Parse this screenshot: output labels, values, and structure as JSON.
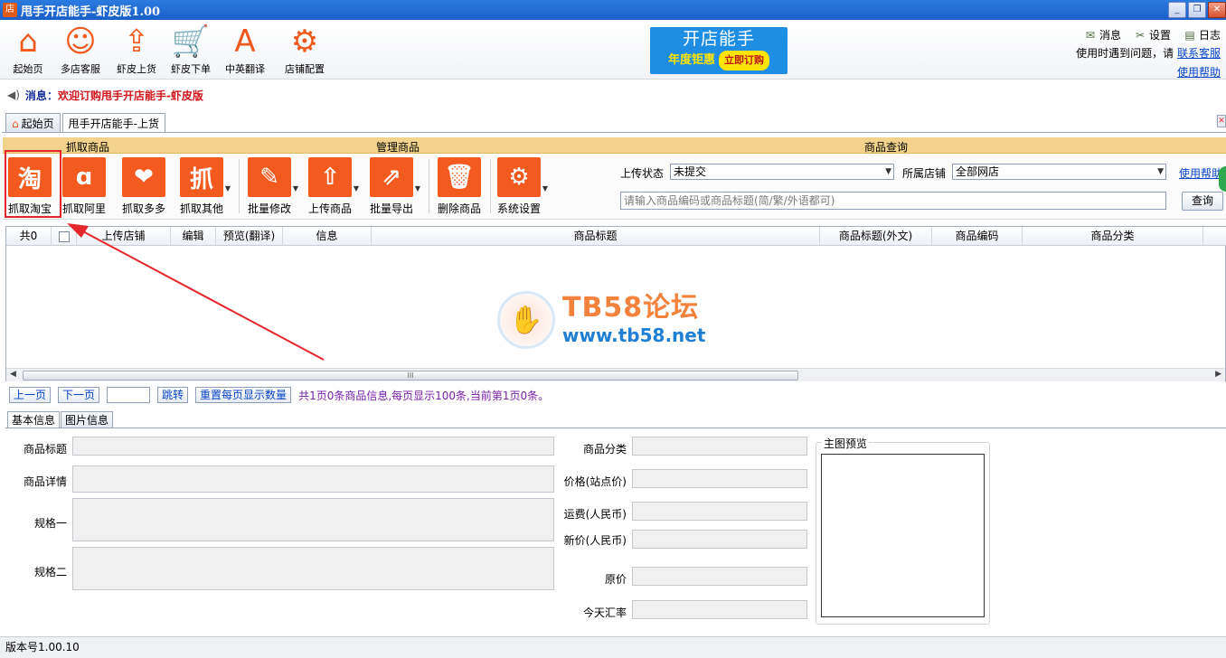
{
  "window": {
    "title": "甩手开店能手-虾皮版1.00",
    "app_icon": "店",
    "minimize": "_",
    "restore": "❐",
    "close": "✕"
  },
  "topbar": {
    "buttons": [
      {
        "label": "起始页",
        "icon": "home-icon",
        "glyph": "⌂"
      },
      {
        "label": "多店客服",
        "icon": "headset-icon",
        "glyph": "☺"
      },
      {
        "label": "虾皮上货",
        "icon": "upload-box-icon",
        "glyph": "⇪"
      },
      {
        "label": "虾皮下单",
        "icon": "cart-icon",
        "glyph": "🛒"
      },
      {
        "label": "中英翻译",
        "icon": "translate-icon",
        "glyph": "A"
      },
      {
        "label": "店铺配置",
        "icon": "gear-icon",
        "glyph": "⚙"
      }
    ],
    "banner": {
      "line1": "开店能手",
      "line2": "年度钜惠",
      "cta": "立即订购"
    },
    "right": {
      "messages": "消息",
      "settings": "设置",
      "log": "日志",
      "help_prompt": "使用时遇到问题，请",
      "contact_link": "联系客服",
      "help_link": "使用帮助"
    }
  },
  "message": {
    "label": "消息：",
    "text": "欢迎订购甩手开店能手-虾皮版"
  },
  "doc_tabs": [
    {
      "label": "起始页",
      "active": false
    },
    {
      "label": "甩手开店能手-上货",
      "active": true
    }
  ],
  "ribbon": {
    "groups": {
      "grab": "抓取商品",
      "manage": "管理商品",
      "query": "商品查询"
    },
    "buttons": [
      {
        "label": "抓取淘宝",
        "glyph": "淘"
      },
      {
        "label": "抓取阿里",
        "glyph": "ɑ"
      },
      {
        "label": "抓取多多",
        "glyph": "❤"
      },
      {
        "label": "抓取其他",
        "glyph": "抓"
      },
      {
        "label": "批量修改",
        "glyph": "✎"
      },
      {
        "label": "上传商品",
        "glyph": "⇧"
      },
      {
        "label": "批量导出",
        "glyph": "⇗"
      },
      {
        "label": "删除商品",
        "glyph": "🗑"
      },
      {
        "label": "系统设置",
        "glyph": "⚙"
      }
    ],
    "query": {
      "upload_status_label": "上传状态",
      "upload_status_value": "未提交",
      "shop_label": "所属店铺",
      "shop_value": "全部网店",
      "help_link": "使用帮助",
      "search_placeholder": "请输入商品编码或商品标题(简/繁/外语都可)",
      "search_button": "查询"
    }
  },
  "grid": {
    "columns": [
      "共0",
      "",
      "上传店铺",
      "编辑",
      "预览(翻译)",
      "信息",
      "商品标题",
      "商品标题(外文)",
      "商品编码",
      "商品分类"
    ],
    "rows": [],
    "scroll_grip": "III"
  },
  "watermark": {
    "line1": "TB58论坛",
    "line2": "www.tb58.net"
  },
  "pager": {
    "prev": "上一页",
    "next": "下一页",
    "jump": "跳转",
    "reset": "重置每页显示数量",
    "info": "共1页0条商品信息,每页显示100条,当前第1页0条。"
  },
  "detail_tabs": [
    {
      "label": "基本信息",
      "active": true
    },
    {
      "label": "图片信息",
      "active": false
    }
  ],
  "detail": {
    "title_label": "商品标题",
    "desc_label": "商品详情",
    "spec1_label": "规格一",
    "spec2_label": "规格二",
    "category_label": "商品分类",
    "site_price_label": "价格(站点价)",
    "shipping_label": "运费(人民币)",
    "new_price_label": "新价(人民币)",
    "orig_price_label": "原价",
    "rate_label": "今天汇率",
    "preview_label": "主图预览"
  },
  "status": {
    "version": "版本号1.00.10"
  },
  "colors": {
    "accent": "#f35a1f",
    "ribbon_head": "#f3d38c",
    "highlight": "#e6262d",
    "link": "#0645c8"
  }
}
